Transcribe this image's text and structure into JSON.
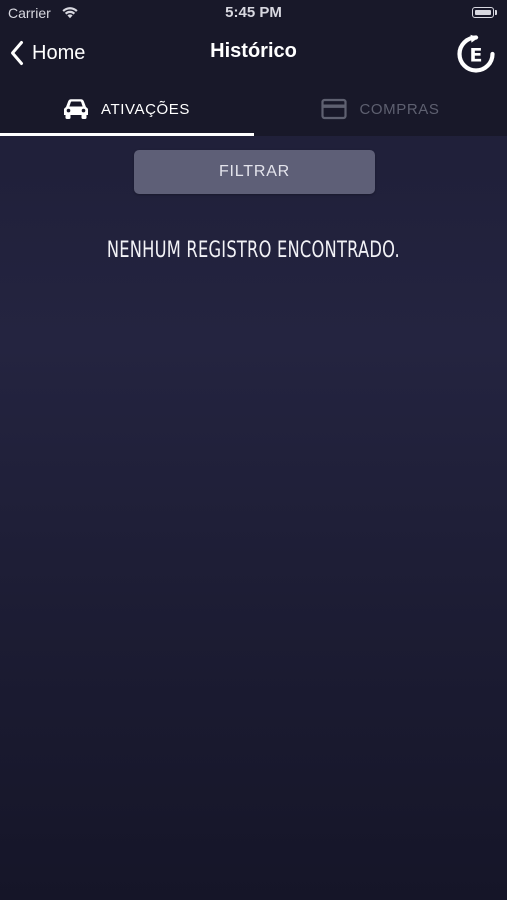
{
  "status_bar": {
    "carrier": "Carrier",
    "time": "5:45 PM",
    "wifi_icon": "wifi-icon",
    "battery_icon": "battery-icon"
  },
  "nav": {
    "back_label": "Home",
    "back_icon": "chevron-left-icon",
    "title": "Histórico",
    "logo_letter": "E",
    "logo_icon": "refresh-e-logo-icon"
  },
  "tabs": [
    {
      "label": "ATIVAÇÕES",
      "icon": "car-icon",
      "active": true
    },
    {
      "label": "COMPRAS",
      "icon": "credit-card-icon",
      "active": false
    }
  ],
  "filter": {
    "label": "FILTRAR"
  },
  "empty_state": {
    "message": "NENHUM REGISTRO ENCONTRADO."
  },
  "colors": {
    "background": "#1f1f38",
    "header": "#181829",
    "active_tab": "#ffffff",
    "inactive_tab": "#5e6070",
    "filter_button": "#5e5f77"
  }
}
